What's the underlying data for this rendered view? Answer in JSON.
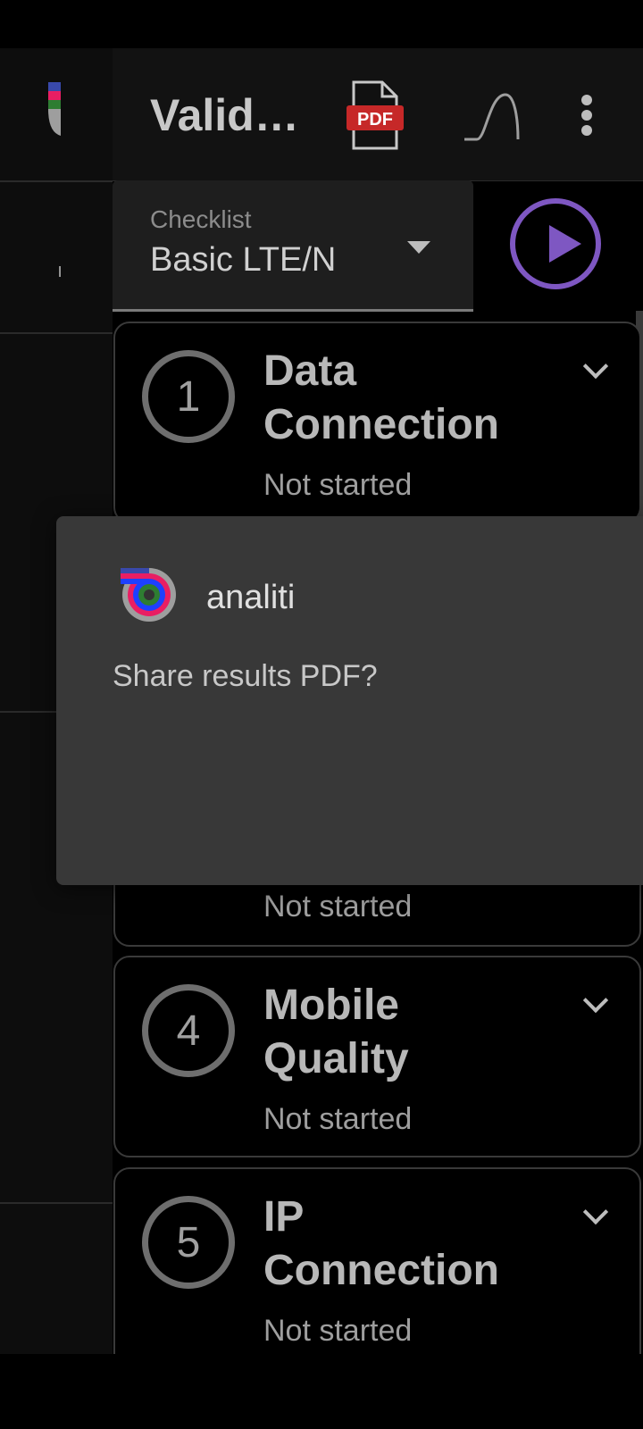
{
  "app_bar": {
    "title": "Valid…",
    "pdf_icon": "pdf-file-icon",
    "pdf_text": "PDF",
    "curve_icon": "signal-curve-icon",
    "more_icon": "more-vert-icon"
  },
  "checklist": {
    "label": "Checklist",
    "value": "Basic LTE/N"
  },
  "play_icon": "play-circle-icon",
  "cards": [
    {
      "number": "1",
      "title_lines": [
        "Data",
        "Connection"
      ],
      "status": "Not started"
    },
    {
      "number": "4",
      "title_lines": [
        "Mobile",
        "Quality"
      ],
      "status": "Not started"
    },
    {
      "number": "5",
      "title_lines": [
        "IP",
        "Connection"
      ],
      "status": "Not started"
    }
  ],
  "covered_card_status": "Not started",
  "dialog": {
    "app_name": "analiti",
    "message": "Share results PDF?"
  },
  "colors": {
    "accent": "#7e57c2",
    "pdf_red": "#c62828",
    "dialog_bg": "#383838"
  }
}
